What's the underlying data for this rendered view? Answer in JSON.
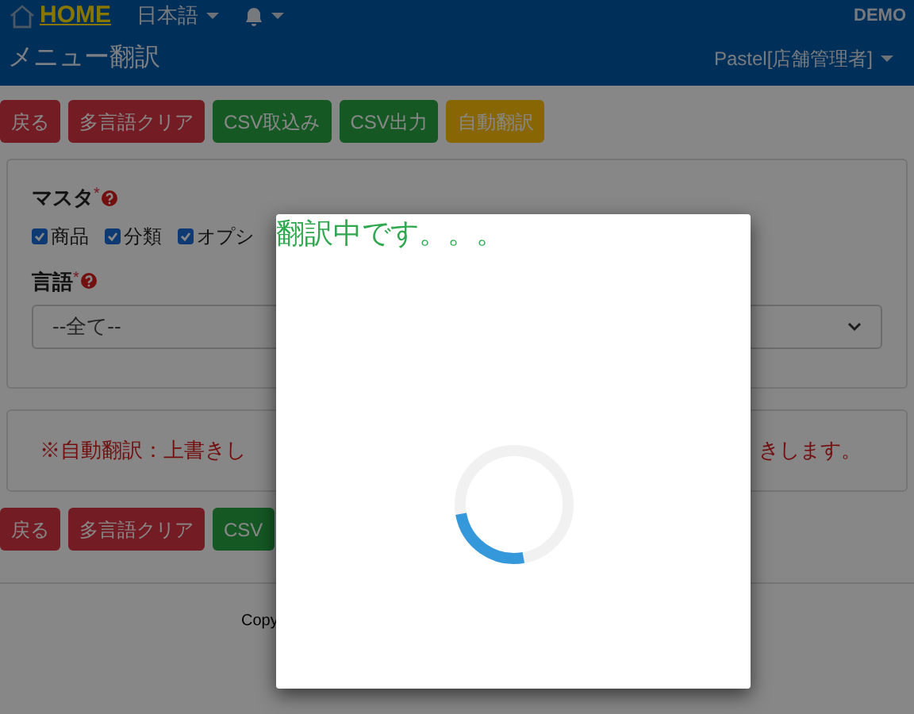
{
  "navbar": {
    "home": "HOME",
    "language": "日本語",
    "demo": "DEMO"
  },
  "page_title": "メニュー翻訳",
  "user": "Pastel[店舗管理者]",
  "top_buttons": [
    {
      "label": "戻る",
      "kind": "danger"
    },
    {
      "label": "多言語クリア",
      "kind": "danger"
    },
    {
      "label": "CSV取込み",
      "kind": "success"
    },
    {
      "label": "CSV出力",
      "kind": "success"
    },
    {
      "label": "自動翻訳",
      "kind": "warning"
    }
  ],
  "master": {
    "label": "マスタ",
    "required_mark": "*",
    "options": [
      {
        "label": "商品",
        "checked": true
      },
      {
        "label": "分類",
        "checked": true
      },
      {
        "label": "オプシ",
        "checked": true
      }
    ]
  },
  "language": {
    "label": "言語",
    "required_mark": "*",
    "value": "--全て--"
  },
  "notice": {
    "left": "※自動翻訳：上書きし",
    "right": "きします。"
  },
  "bottom_buttons": [
    {
      "label": "戻る",
      "kind": "danger"
    },
    {
      "label": "多言語クリア",
      "kind": "danger"
    },
    {
      "label": "CSV",
      "kind": "success"
    }
  ],
  "footer": "Copy",
  "modal": {
    "title": "翻訳中です。。。"
  }
}
